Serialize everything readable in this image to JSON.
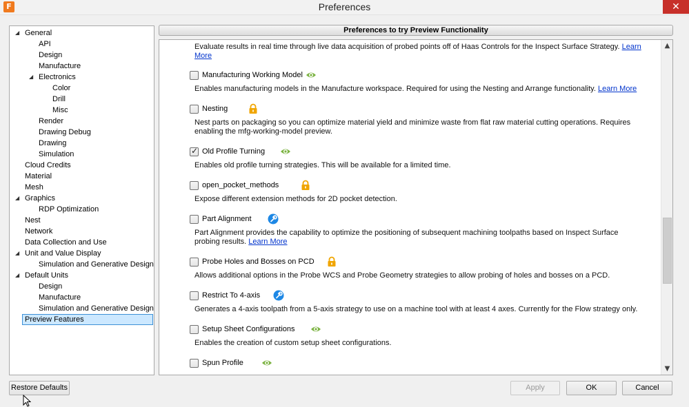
{
  "window": {
    "title": "Preferences",
    "app_icon_letter": "F",
    "close_glyph": "✕"
  },
  "tree": {
    "items": [
      {
        "label": "General",
        "arrow": "◢"
      },
      {
        "label": "API"
      },
      {
        "label": "Design"
      },
      {
        "label": "Manufacture"
      },
      {
        "label": "Electronics",
        "arrow": "◢"
      },
      {
        "label": "Color"
      },
      {
        "label": "Drill"
      },
      {
        "label": "Misc"
      },
      {
        "label": "Render"
      },
      {
        "label": "Drawing Debug"
      },
      {
        "label": "Drawing"
      },
      {
        "label": "Simulation"
      },
      {
        "label": "Cloud Credits"
      },
      {
        "label": "Material"
      },
      {
        "label": "Mesh"
      },
      {
        "label": "Graphics",
        "arrow": "◢"
      },
      {
        "label": "RDP Optimization"
      },
      {
        "label": "Nest"
      },
      {
        "label": "Network"
      },
      {
        "label": "Data Collection and Use"
      },
      {
        "label": "Unit and Value Display",
        "arrow": "◢"
      },
      {
        "label": "Simulation and Generative Design"
      },
      {
        "label": "Default Units",
        "arrow": "◢"
      },
      {
        "label": "Design"
      },
      {
        "label": "Manufacture"
      },
      {
        "label": "Simulation and Generative Design"
      },
      {
        "label": "Preview Features",
        "selected": true
      }
    ]
  },
  "panel": {
    "header": "Preferences to try Preview Functionality",
    "top_desc": "Evaluate results in real time through live data acquisition of probed points off of Haas Controls for the Inspect Surface Strategy.",
    "top_link": "Learn More",
    "features": [
      {
        "label": "Manufacturing Working Model",
        "checked": false,
        "badge": "eye-icon",
        "desc": "Enables manufacturing models in the Manufacture workspace. Required for using the Nesting and Arrange functionality.",
        "link": "Learn More"
      },
      {
        "label": "Nesting",
        "checked": false,
        "badge": "lock-icon",
        "desc": "Nest parts on packaging so you can optimize material yield and minimize waste from flat raw material cutting operations. Requires enabling the mfg-working-model preview.",
        "link": ""
      },
      {
        "label": "Old Profile Turning",
        "checked": true,
        "badge": "eye-icon",
        "desc": "Enables old profile turning strategies. This will be available for a limited time.",
        "link": ""
      },
      {
        "label": "open_pocket_methods",
        "checked": false,
        "badge": "lock-icon",
        "desc": "Expose different extension methods for 2D pocket detection.",
        "link": ""
      },
      {
        "label": "Part Alignment",
        "checked": false,
        "badge": "wrench-icon",
        "desc": "Part Alignment provides the capability to optimize the positioning of subsequent machining toolpaths based on Inspect Surface probing results.",
        "link": "Learn More"
      },
      {
        "label": "Probe Holes and Bosses on PCD",
        "checked": false,
        "badge": "lock-icon",
        "desc": "Allows additional options in the Probe WCS and Probe Geometry strategies to allow probing of holes and bosses on a PCD.",
        "link": ""
      },
      {
        "label": "Restrict To 4-axis",
        "checked": false,
        "badge": "wrench-icon",
        "desc": "Generates a 4-axis toolpath from a 5-axis strategy to use on a machine tool with at least 4 axes. Currently for the Flow strategy only.",
        "link": ""
      },
      {
        "label": "Setup Sheet Configurations",
        "checked": false,
        "badge": "eye-icon",
        "desc": "Enables the creation of custom setup sheet configurations.",
        "link": ""
      },
      {
        "label": "Spun Profile",
        "checked": false,
        "badge": "eye-icon",
        "desc": "",
        "link": ""
      }
    ]
  },
  "buttons": {
    "restore": "Restore Defaults",
    "apply": "Apply",
    "ok": "OK",
    "cancel": "Cancel"
  },
  "colors": {
    "eye": "#7cb342",
    "lock": "#f0a500",
    "wrench": "#1e88e5",
    "link": "#0033cc",
    "selection": "#cce8ff"
  }
}
